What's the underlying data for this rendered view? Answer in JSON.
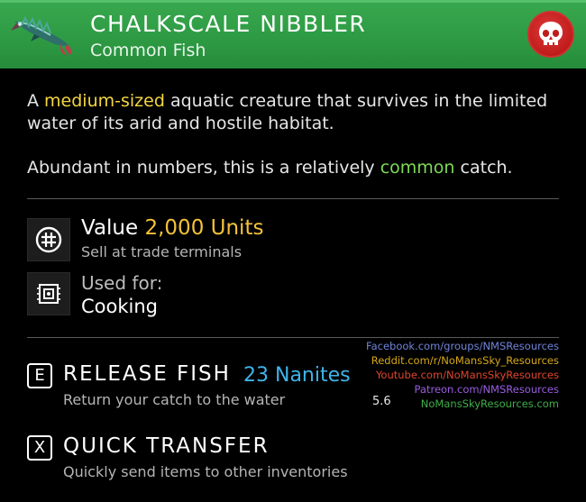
{
  "item": {
    "name": "CHALKSCALE NIBBLER",
    "category": "Common Fish"
  },
  "description": {
    "p1_before": "A ",
    "p1_highlight": "medium-sized",
    "p1_after": " aquatic creature that survives in the limited water of its arid and hostile habitat.",
    "p2_before": "Abundant in numbers, this is a relatively ",
    "p2_highlight": "common",
    "p2_after": " catch."
  },
  "value": {
    "label": "Value",
    "amount": "2,000 Units",
    "subtitle": "Sell at trade terminals"
  },
  "used_for": {
    "label": "Used for:",
    "value": "Cooking"
  },
  "actions": [
    {
      "key": "E",
      "label": "RELEASE FISH",
      "cost": "23 Nanites",
      "subtitle": "Return your catch to the water"
    },
    {
      "key": "X",
      "label": "QUICK TRANSFER",
      "subtitle": "Quickly send items to other inventories"
    }
  ],
  "credits": [
    "Facebook.com/groups/NMSResources",
    "Reddit.com/r/NoMansSky_Resources",
    "Youtube.com/NoMansSkyResources",
    "Patreon.com/NMSResources",
    "NoMansSkyResources.com"
  ],
  "version": "5.6",
  "colors": {
    "header_green": "#2d9a43",
    "value_gold": "#f4c23a",
    "highlight_yellow": "#f4d641",
    "highlight_green": "#7ed957",
    "nanites_blue": "#3fb4ea",
    "skull_red": "#c01c1c"
  },
  "icons": {
    "item": "fish-icon",
    "rarity": "skull-icon",
    "value": "units-currency-icon",
    "used_for": "cooking-chip-icon"
  }
}
